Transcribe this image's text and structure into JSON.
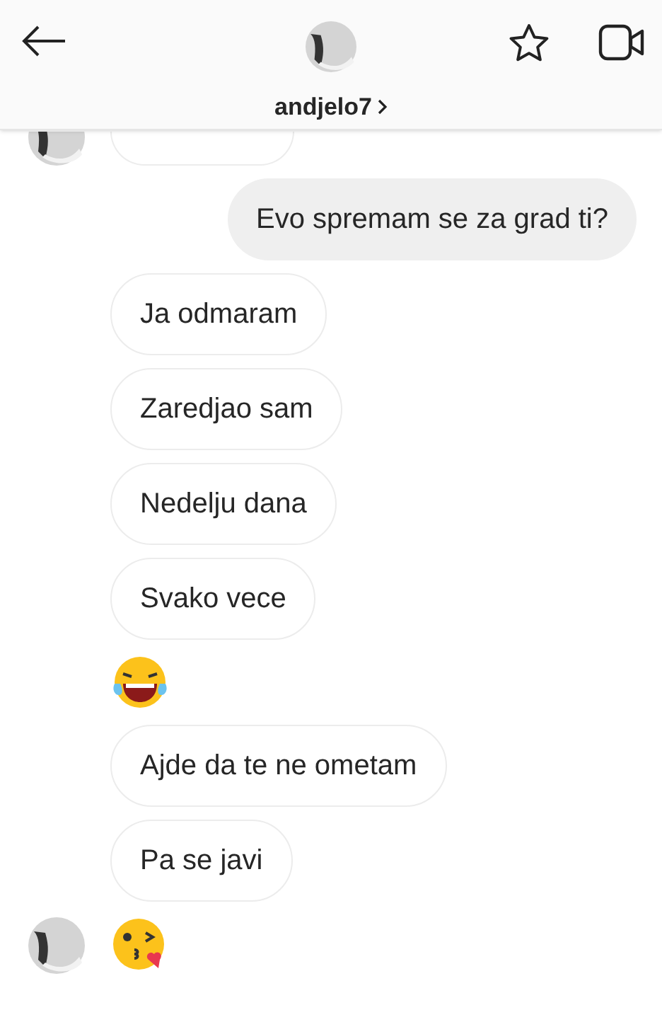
{
  "header": {
    "username": "andjelo7"
  },
  "messages": [
    {
      "kind": "cut",
      "outgoing": false,
      "avatar": true
    },
    {
      "kind": "text",
      "outgoing": true,
      "avatar": false,
      "text": "Evo spremam se za grad ti?"
    },
    {
      "kind": "text",
      "outgoing": false,
      "avatar": false,
      "text": "Ja odmaram"
    },
    {
      "kind": "text",
      "outgoing": false,
      "avatar": false,
      "text": "Zaredjao sam"
    },
    {
      "kind": "text",
      "outgoing": false,
      "avatar": false,
      "text": "Nedelju dana"
    },
    {
      "kind": "text",
      "outgoing": false,
      "avatar": false,
      "text": "Svako vece"
    },
    {
      "kind": "laugh",
      "outgoing": false,
      "avatar": false
    },
    {
      "kind": "text",
      "outgoing": false,
      "avatar": false,
      "text": "Ajde da te ne ometam"
    },
    {
      "kind": "text",
      "outgoing": false,
      "avatar": false,
      "text": "Pa se javi"
    },
    {
      "kind": "kiss",
      "outgoing": false,
      "avatar": true
    }
  ]
}
